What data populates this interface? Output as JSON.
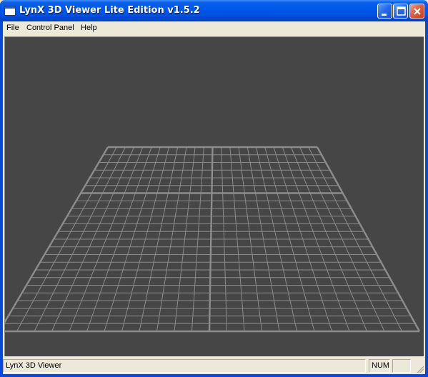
{
  "window": {
    "title": "LynX 3D Viewer Lite Edition v1.5.2"
  },
  "menu": {
    "items": [
      "File",
      "Control Panel",
      "Help"
    ]
  },
  "viewport": {
    "background_color": "#464646",
    "grid_color": "#8c8c8c",
    "content": "3D perspective ground grid"
  },
  "statusbar": {
    "main_text": "LynX 3D Viewer",
    "num_indicator": "NUM",
    "extra_indicator": ""
  },
  "icons": {
    "app": "app-window-icon",
    "minimize": "minimize-icon",
    "maximize": "maximize-icon",
    "close": "close-icon",
    "grip": "resize-grip-icon"
  },
  "colors": {
    "titlebar": "#0058ee",
    "close_button": "#e05a34",
    "chrome": "#ece9d8"
  }
}
